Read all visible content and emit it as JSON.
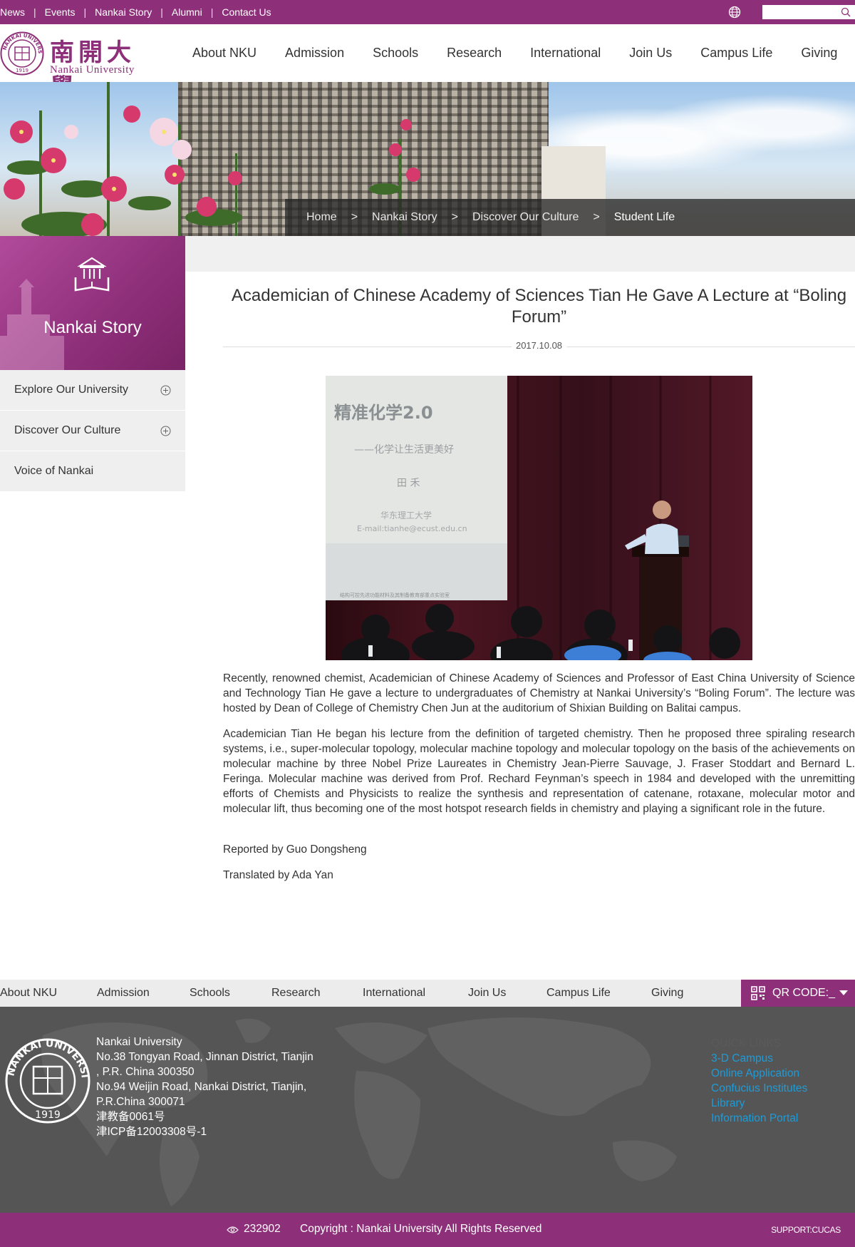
{
  "topbar": {
    "links": [
      "News",
      "Events",
      "Nankai Story",
      "Alumni",
      "Contact Us"
    ],
    "search_placeholder": "",
    "icons": [
      "globe-icon",
      "search-icon"
    ],
    "colors": {
      "brand": "#8e2f7a"
    }
  },
  "header": {
    "logo_cn": "南開大學",
    "logo_en": "Nankai University",
    "seal_text": "NANKAI UNIVERSITY",
    "seal_year": "1919",
    "nav": [
      "About NKU",
      "Admission",
      "Schools",
      "Research",
      "International",
      "Join Us",
      "Campus Life",
      "Giving"
    ]
  },
  "breadcrumb": {
    "items": [
      "Home",
      "Nankai Story",
      "Discover Our Culture"
    ],
    "current": "Student Life",
    "separator": ">"
  },
  "sidebar": {
    "title": "Nankai Story",
    "icon": "library-book-icon",
    "items": [
      {
        "label": "Explore Our University",
        "expandable": true
      },
      {
        "label": "Discover Our Culture",
        "expandable": true
      },
      {
        "label": "Voice of Nankai",
        "expandable": false
      }
    ]
  },
  "article": {
    "title": "Academician of Chinese Academy of Sciences Tian He Gave A Lecture at “Boling Forum”",
    "date": "2017.10.08",
    "photo": {
      "slide_title": "精准化学2.0",
      "slide_subtitle": "——化学让生活更美好",
      "slide_name": "田 禾",
      "slide_affiliation": "华东理工大学",
      "slide_email": "E-mail:tianhe@ecust.edu.cn",
      "slide_footer": "结构可控先进功能材料及其制备教育部重点实验室"
    },
    "paragraphs": [
      "Recently, renowned chemist, Academician of Chinese Academy of Sciences and Professor of East China University of Science and Technology Tian He gave a lecture to undergraduates of Chemistry at Nankai University’s “Boling Forum”. The lecture was hosted by Dean of College of Chemistry Chen Jun at the auditorium of Shixian Building on Balitai campus.",
      "Academician Tian He began his lecture from the definition of targeted chemistry. Then he proposed three spiraling research systems, i.e., super-molecular topology, molecular machine topology and molecular topology on the basis of the achievements on molecular machine by three Nobel Prize Laureates in Chemistry Jean-Pierre Sauvage, J. Fraser Stoddart and Bernard L. Feringa. Molecular machine was derived from Prof. Rechard Feynman’s speech in 1984 and developed with the unremitting efforts of Chemists and Physicists to realize the synthesis and representation of catenane, rotaxane, molecular motor and molecular lift, thus becoming one of the most hotspot research fields in chemistry and playing a significant role in the future."
    ],
    "reporter": "Reported by Guo Dongsheng",
    "translator": "Translated by Ada Yan"
  },
  "footer": {
    "nav": [
      "About NKU",
      "Admission",
      "Schools",
      "Research",
      "International",
      "Join Us",
      "Campus Life",
      "Giving"
    ],
    "qr_label": "QR CODE:_",
    "address_lines": [
      "Nankai University",
      "No.38 Tongyan Road, Jinnan District, Tianjin",
      ", P.R. China 300350",
      "No.94 Weijin Road,  Nankai District, Tianjin,",
      "P.R.China  300071",
      "津教备0061号",
      "津ICP备12003308号-1"
    ],
    "quick_links_title": "QUICK LINKS",
    "quick_links": [
      "3-D Campus",
      "Online Application",
      "Confucius Institutes",
      "Library",
      "Information Portal"
    ],
    "visit_count": "232902",
    "copyright": "Copyright : Nankai University All Rights Reserved",
    "support": "SUPPORT:CUCAS",
    "colors": {
      "link": "#1e9bd7",
      "footer_bg": "#555555"
    }
  }
}
